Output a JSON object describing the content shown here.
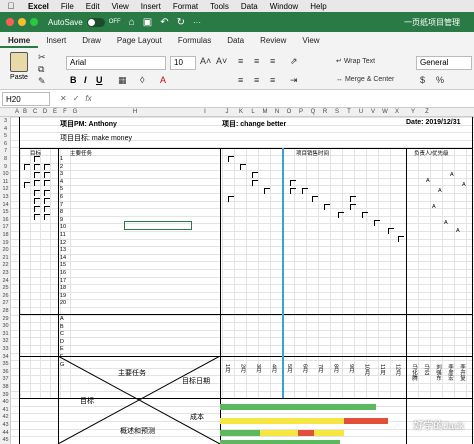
{
  "menubar": {
    "app": "Excel",
    "items": [
      "File",
      "Edit",
      "View",
      "Insert",
      "Format",
      "Tools",
      "Data",
      "Window",
      "Help"
    ]
  },
  "titlebar": {
    "autosave_label": "AutoSave",
    "autosave_state": "OFF",
    "window_title": "一页纸项目管理"
  },
  "tabs": [
    "Home",
    "Insert",
    "Draw",
    "Page Layout",
    "Formulas",
    "Data",
    "Review",
    "View"
  ],
  "ribbon": {
    "paste_label": "Paste",
    "font_name": "Arial",
    "font_size": "10",
    "wrap_text": "Wrap Text",
    "merge_center": "Merge & Center",
    "number_format": "General"
  },
  "formula_bar": {
    "name_box": "H20",
    "fx": "fx"
  },
  "sheet": {
    "header_pm": "项目PM: Anthony",
    "header_project": "项目: change better",
    "header_date": "Date: 2019/12/31",
    "header_goal": "项目目标: make money",
    "col_goal": "目标",
    "col_main_task": "主要任务",
    "col_timeline": "项目销售时间",
    "col_owner": "负责人/优先级",
    "task_numbers": [
      "1",
      "2",
      "3",
      "4",
      "5",
      "6",
      "7",
      "8",
      "9",
      "10",
      "11",
      "12",
      "13",
      "14",
      "15",
      "16",
      "17",
      "18",
      "19",
      "20"
    ],
    "lower_letters": [
      "A",
      "B",
      "C",
      "D",
      "E",
      "F",
      "G"
    ],
    "months": [
      "1月",
      "2月",
      "3月",
      "4月",
      "5月",
      "6月",
      "7月",
      "8月",
      "9月",
      "10月",
      "11月",
      "12月"
    ],
    "bottom_main_task": "主要任务",
    "bottom_target_date": "目标日期",
    "bottom_goal": "目标",
    "bottom_cost": "成本",
    "bottom_summary": "概述和预测",
    "owner_letters": [
      "A",
      "A",
      "A",
      "A",
      "A",
      "A",
      "A"
    ],
    "owner_labels": [
      "马化腾",
      "马云",
      "刘强东",
      "李彦宏",
      "李开复"
    ]
  },
  "watermark": "好学的Jack",
  "colors": {
    "titlebar": "#2a7a45",
    "green": "#5cb85c",
    "yellow": "#f5e642",
    "red": "#e3503a",
    "blue_line": "#3aa0d8"
  }
}
